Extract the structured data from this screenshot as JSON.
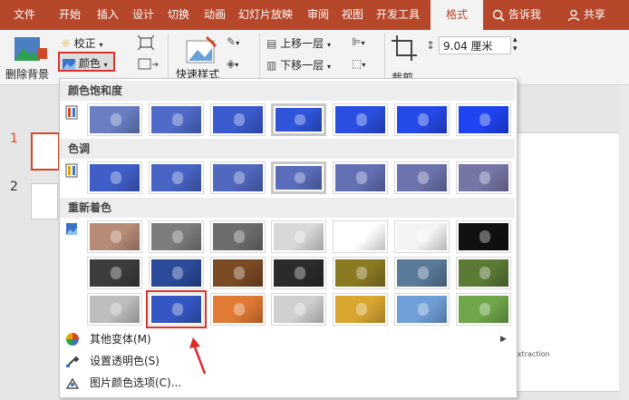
{
  "tabs": {
    "file": "文件",
    "home": "开始",
    "insert": "插入",
    "design": "设计",
    "transitions": "切换",
    "animations": "动画",
    "slideshow": "幻灯片放映",
    "review": "审阅",
    "view": "视图",
    "developer": "开发工具",
    "format": "格式",
    "tell_me": "告诉我",
    "share": "共享"
  },
  "ribbon": {
    "remove_bg": "删除背景",
    "corrections": "校正",
    "color": "颜色",
    "quick_styles": "快速样式",
    "bring_forward": "上移一层",
    "send_backward": "下移一层",
    "crop": "裁剪",
    "width_value": "9.04 厘米"
  },
  "slides": {
    "num1": "1",
    "num2": "2"
  },
  "slide_text": "extraction",
  "dropdown": {
    "saturation_header": "颜色饱和度",
    "tone_header": "色调",
    "recolor_header": "重新着色",
    "more_variations": "其他变体(M)",
    "set_transparent": "设置透明色(S)",
    "picture_color_options": "图片颜色选项(C)..."
  },
  "swatches": {
    "saturation": [
      "#6b7ec4",
      "#4f6ac8",
      "#3b5bd0",
      "#2f54d8",
      "#2a4fe0",
      "#2549e8",
      "#1f43f0"
    ],
    "tone": [
      "#3f5ec8",
      "#4864c4",
      "#5168bf",
      "#5a6cba",
      "#6370b4",
      "#6d73ad",
      "#7676a6"
    ],
    "recolor_row1": [
      "#b88a78",
      "#7d7d7d",
      "#6d6d6d",
      "#d8d8d8",
      "#ffffff",
      "#f4f4f4",
      "#111111"
    ],
    "recolor_row2": [
      "#3c3c3c",
      "#2b4a9a",
      "#7a4a25",
      "#2b2b2b",
      "#8a7a22",
      "#5a7a99",
      "#5a7a35"
    ],
    "recolor_row3": [
      "#bdbdbd",
      "#3557c4",
      "#e07a35",
      "#cfcfcf",
      "#d9a630",
      "#6f9fd6",
      "#6fa64a"
    ]
  },
  "selected": {
    "saturation": 3,
    "tone": 3
  },
  "highlighted": {
    "row": 3,
    "index": 1
  },
  "colors": {
    "accent": "#b7472a",
    "highlight": "#d9342b"
  }
}
